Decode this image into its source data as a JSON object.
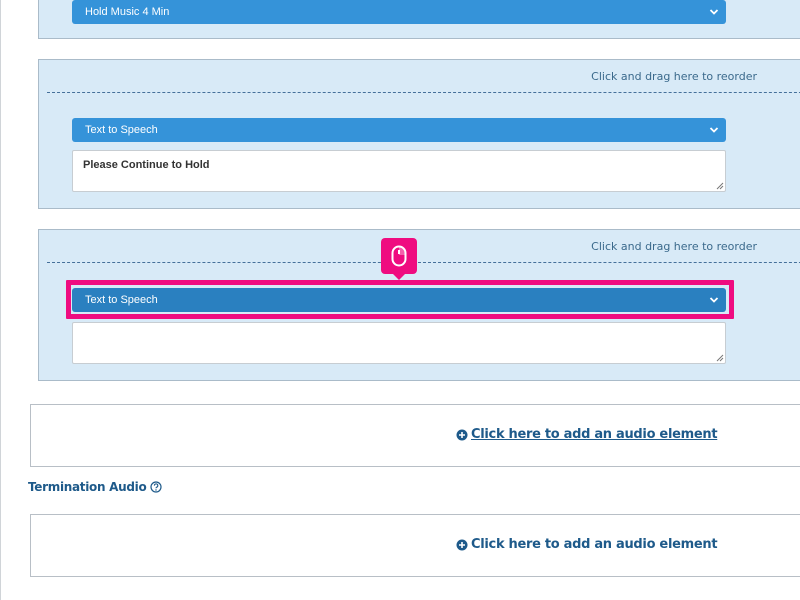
{
  "blocks": [
    {
      "select_value": "Hold Music 4 Min"
    },
    {
      "drag_hint": "Click and drag here to reorder",
      "select_value": "Text to Speech",
      "textarea_value": "Please Continue to Hold"
    },
    {
      "drag_hint": "Click and drag here to reorder",
      "select_value": "Text to Speech",
      "textarea_value": ""
    }
  ],
  "add_audio_label": "Click here to add an audio element",
  "termination_audio": {
    "title": "Termination Audio",
    "add_audio_label": "Click here to add an audio element"
  },
  "colors": {
    "card_bg": "#d8eaf7",
    "select_bg": "#3593d9",
    "highlight": "#ef0c80",
    "link": "#1e5a8a"
  },
  "icons": [
    "chevron-down-icon",
    "resize-grip-icon",
    "mouse-icon",
    "plus-circle-icon",
    "help-circle-icon"
  ]
}
